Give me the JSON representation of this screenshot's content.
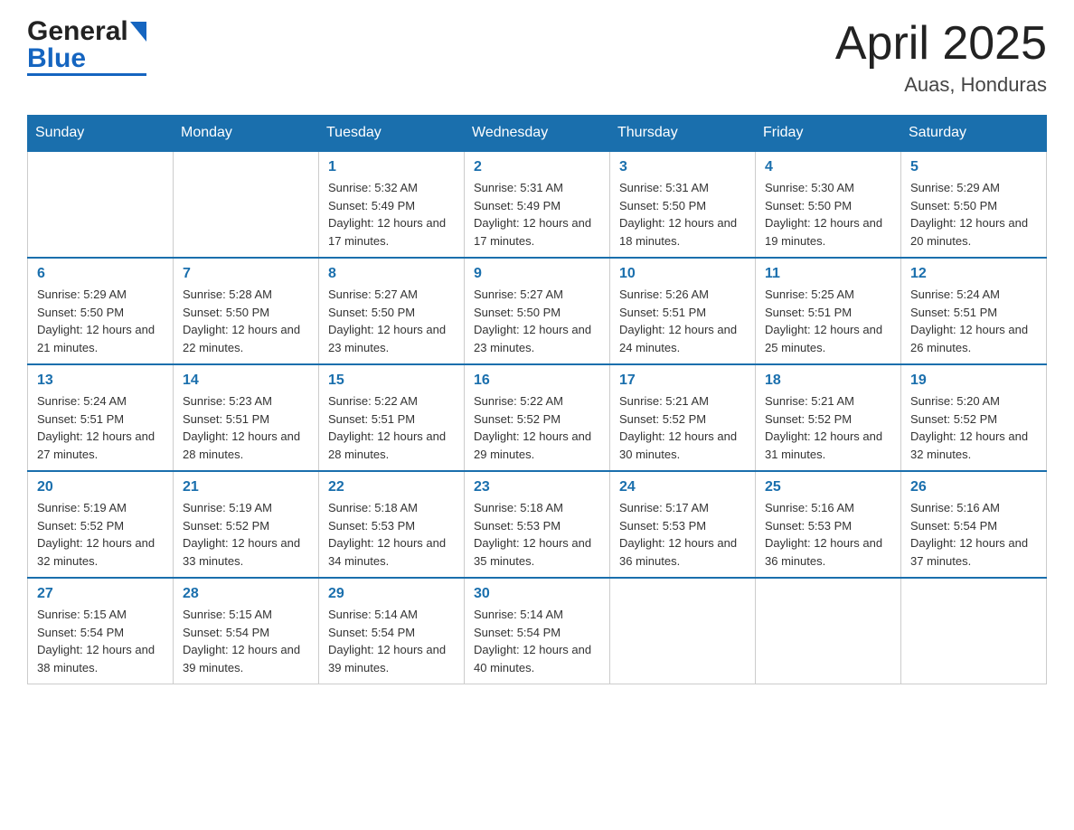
{
  "logo": {
    "general": "General",
    "blue": "Blue"
  },
  "title": {
    "month_year": "April 2025",
    "location": "Auas, Honduras"
  },
  "weekdays": [
    "Sunday",
    "Monday",
    "Tuesday",
    "Wednesday",
    "Thursday",
    "Friday",
    "Saturday"
  ],
  "weeks": [
    [
      {
        "day": "",
        "sunrise": "",
        "sunset": "",
        "daylight": ""
      },
      {
        "day": "",
        "sunrise": "",
        "sunset": "",
        "daylight": ""
      },
      {
        "day": "1",
        "sunrise": "Sunrise: 5:32 AM",
        "sunset": "Sunset: 5:49 PM",
        "daylight": "Daylight: 12 hours and 17 minutes."
      },
      {
        "day": "2",
        "sunrise": "Sunrise: 5:31 AM",
        "sunset": "Sunset: 5:49 PM",
        "daylight": "Daylight: 12 hours and 17 minutes."
      },
      {
        "day": "3",
        "sunrise": "Sunrise: 5:31 AM",
        "sunset": "Sunset: 5:50 PM",
        "daylight": "Daylight: 12 hours and 18 minutes."
      },
      {
        "day": "4",
        "sunrise": "Sunrise: 5:30 AM",
        "sunset": "Sunset: 5:50 PM",
        "daylight": "Daylight: 12 hours and 19 minutes."
      },
      {
        "day": "5",
        "sunrise": "Sunrise: 5:29 AM",
        "sunset": "Sunset: 5:50 PM",
        "daylight": "Daylight: 12 hours and 20 minutes."
      }
    ],
    [
      {
        "day": "6",
        "sunrise": "Sunrise: 5:29 AM",
        "sunset": "Sunset: 5:50 PM",
        "daylight": "Daylight: 12 hours and 21 minutes."
      },
      {
        "day": "7",
        "sunrise": "Sunrise: 5:28 AM",
        "sunset": "Sunset: 5:50 PM",
        "daylight": "Daylight: 12 hours and 22 minutes."
      },
      {
        "day": "8",
        "sunrise": "Sunrise: 5:27 AM",
        "sunset": "Sunset: 5:50 PM",
        "daylight": "Daylight: 12 hours and 23 minutes."
      },
      {
        "day": "9",
        "sunrise": "Sunrise: 5:27 AM",
        "sunset": "Sunset: 5:50 PM",
        "daylight": "Daylight: 12 hours and 23 minutes."
      },
      {
        "day": "10",
        "sunrise": "Sunrise: 5:26 AM",
        "sunset": "Sunset: 5:51 PM",
        "daylight": "Daylight: 12 hours and 24 minutes."
      },
      {
        "day": "11",
        "sunrise": "Sunrise: 5:25 AM",
        "sunset": "Sunset: 5:51 PM",
        "daylight": "Daylight: 12 hours and 25 minutes."
      },
      {
        "day": "12",
        "sunrise": "Sunrise: 5:24 AM",
        "sunset": "Sunset: 5:51 PM",
        "daylight": "Daylight: 12 hours and 26 minutes."
      }
    ],
    [
      {
        "day": "13",
        "sunrise": "Sunrise: 5:24 AM",
        "sunset": "Sunset: 5:51 PM",
        "daylight": "Daylight: 12 hours and 27 minutes."
      },
      {
        "day": "14",
        "sunrise": "Sunrise: 5:23 AM",
        "sunset": "Sunset: 5:51 PM",
        "daylight": "Daylight: 12 hours and 28 minutes."
      },
      {
        "day": "15",
        "sunrise": "Sunrise: 5:22 AM",
        "sunset": "Sunset: 5:51 PM",
        "daylight": "Daylight: 12 hours and 28 minutes."
      },
      {
        "day": "16",
        "sunrise": "Sunrise: 5:22 AM",
        "sunset": "Sunset: 5:52 PM",
        "daylight": "Daylight: 12 hours and 29 minutes."
      },
      {
        "day": "17",
        "sunrise": "Sunrise: 5:21 AM",
        "sunset": "Sunset: 5:52 PM",
        "daylight": "Daylight: 12 hours and 30 minutes."
      },
      {
        "day": "18",
        "sunrise": "Sunrise: 5:21 AM",
        "sunset": "Sunset: 5:52 PM",
        "daylight": "Daylight: 12 hours and 31 minutes."
      },
      {
        "day": "19",
        "sunrise": "Sunrise: 5:20 AM",
        "sunset": "Sunset: 5:52 PM",
        "daylight": "Daylight: 12 hours and 32 minutes."
      }
    ],
    [
      {
        "day": "20",
        "sunrise": "Sunrise: 5:19 AM",
        "sunset": "Sunset: 5:52 PM",
        "daylight": "Daylight: 12 hours and 32 minutes."
      },
      {
        "day": "21",
        "sunrise": "Sunrise: 5:19 AM",
        "sunset": "Sunset: 5:52 PM",
        "daylight": "Daylight: 12 hours and 33 minutes."
      },
      {
        "day": "22",
        "sunrise": "Sunrise: 5:18 AM",
        "sunset": "Sunset: 5:53 PM",
        "daylight": "Daylight: 12 hours and 34 minutes."
      },
      {
        "day": "23",
        "sunrise": "Sunrise: 5:18 AM",
        "sunset": "Sunset: 5:53 PM",
        "daylight": "Daylight: 12 hours and 35 minutes."
      },
      {
        "day": "24",
        "sunrise": "Sunrise: 5:17 AM",
        "sunset": "Sunset: 5:53 PM",
        "daylight": "Daylight: 12 hours and 36 minutes."
      },
      {
        "day": "25",
        "sunrise": "Sunrise: 5:16 AM",
        "sunset": "Sunset: 5:53 PM",
        "daylight": "Daylight: 12 hours and 36 minutes."
      },
      {
        "day": "26",
        "sunrise": "Sunrise: 5:16 AM",
        "sunset": "Sunset: 5:54 PM",
        "daylight": "Daylight: 12 hours and 37 minutes."
      }
    ],
    [
      {
        "day": "27",
        "sunrise": "Sunrise: 5:15 AM",
        "sunset": "Sunset: 5:54 PM",
        "daylight": "Daylight: 12 hours and 38 minutes."
      },
      {
        "day": "28",
        "sunrise": "Sunrise: 5:15 AM",
        "sunset": "Sunset: 5:54 PM",
        "daylight": "Daylight: 12 hours and 39 minutes."
      },
      {
        "day": "29",
        "sunrise": "Sunrise: 5:14 AM",
        "sunset": "Sunset: 5:54 PM",
        "daylight": "Daylight: 12 hours and 39 minutes."
      },
      {
        "day": "30",
        "sunrise": "Sunrise: 5:14 AM",
        "sunset": "Sunset: 5:54 PM",
        "daylight": "Daylight: 12 hours and 40 minutes."
      },
      {
        "day": "",
        "sunrise": "",
        "sunset": "",
        "daylight": ""
      },
      {
        "day": "",
        "sunrise": "",
        "sunset": "",
        "daylight": ""
      },
      {
        "day": "",
        "sunrise": "",
        "sunset": "",
        "daylight": ""
      }
    ]
  ]
}
